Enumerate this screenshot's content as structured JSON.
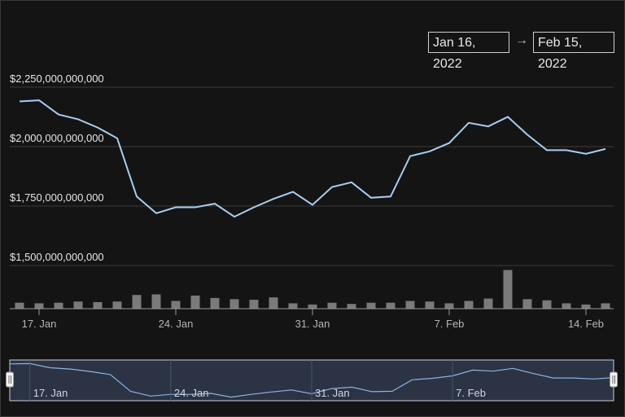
{
  "range_selector": {
    "from": "Jan 16, 2022",
    "arrow": "→",
    "to": "Feb 15, 2022"
  },
  "colors": {
    "line": "#a9cdf0",
    "volume": "#7a7a7a",
    "navigator_fill": "#2b3344",
    "navigator_line": "#8fb3dd"
  },
  "chart_data": {
    "type": "line",
    "title": "",
    "xlabel": "",
    "ylabel": "",
    "ylim": [
      1500000000000,
      2250000000000
    ],
    "y_ticks": [
      "$2,250,000,000,000",
      "$2,000,000,000,000",
      "$1,750,000,000,000",
      "$1,500,000,000,000"
    ],
    "x_ticks": [
      "17. Jan",
      "24. Jan",
      "31. Jan",
      "7. Feb",
      "14. Feb"
    ],
    "navigator_ticks": [
      "17. Jan",
      "24. Jan",
      "31. Jan",
      "7. Feb"
    ],
    "x": [
      "2022-01-16",
      "2022-01-17",
      "2022-01-18",
      "2022-01-19",
      "2022-01-20",
      "2022-01-21",
      "2022-01-22",
      "2022-01-23",
      "2022-01-24",
      "2022-01-25",
      "2022-01-26",
      "2022-01-27",
      "2022-01-28",
      "2022-01-29",
      "2022-01-30",
      "2022-01-31",
      "2022-02-01",
      "2022-02-02",
      "2022-02-03",
      "2022-02-04",
      "2022-02-05",
      "2022-02-06",
      "2022-02-07",
      "2022-02-08",
      "2022-02-09",
      "2022-02-10",
      "2022-02-11",
      "2022-02-12",
      "2022-02-13",
      "2022-02-14",
      "2022-02-15"
    ],
    "series": [
      {
        "values": [
          2190000000000,
          2195000000000,
          2135000000000,
          2115000000000,
          2080000000000,
          2035000000000,
          1790000000000,
          1720000000000,
          1745000000000,
          1745000000000,
          1760000000000,
          1705000000000,
          1745000000000,
          1780000000000,
          1810000000000,
          1755000000000,
          1830000000000,
          1850000000000,
          1785000000000,
          1790000000000,
          1960000000000,
          1980000000000,
          2015000000000,
          2100000000000,
          2085000000000,
          2125000000000,
          2050000000000,
          1985000000000,
          1985000000000,
          1970000000000,
          1990000000000
        ]
      }
    ],
    "volume": [
      0.1,
      0.09,
      0.1,
      0.12,
      0.11,
      0.12,
      0.23,
      0.24,
      0.13,
      0.22,
      0.18,
      0.16,
      0.15,
      0.19,
      0.09,
      0.07,
      0.1,
      0.08,
      0.1,
      0.1,
      0.13,
      0.12,
      0.09,
      0.13,
      0.17,
      0.65,
      0.16,
      0.14,
      0.09,
      0.07,
      0.09
    ]
  }
}
